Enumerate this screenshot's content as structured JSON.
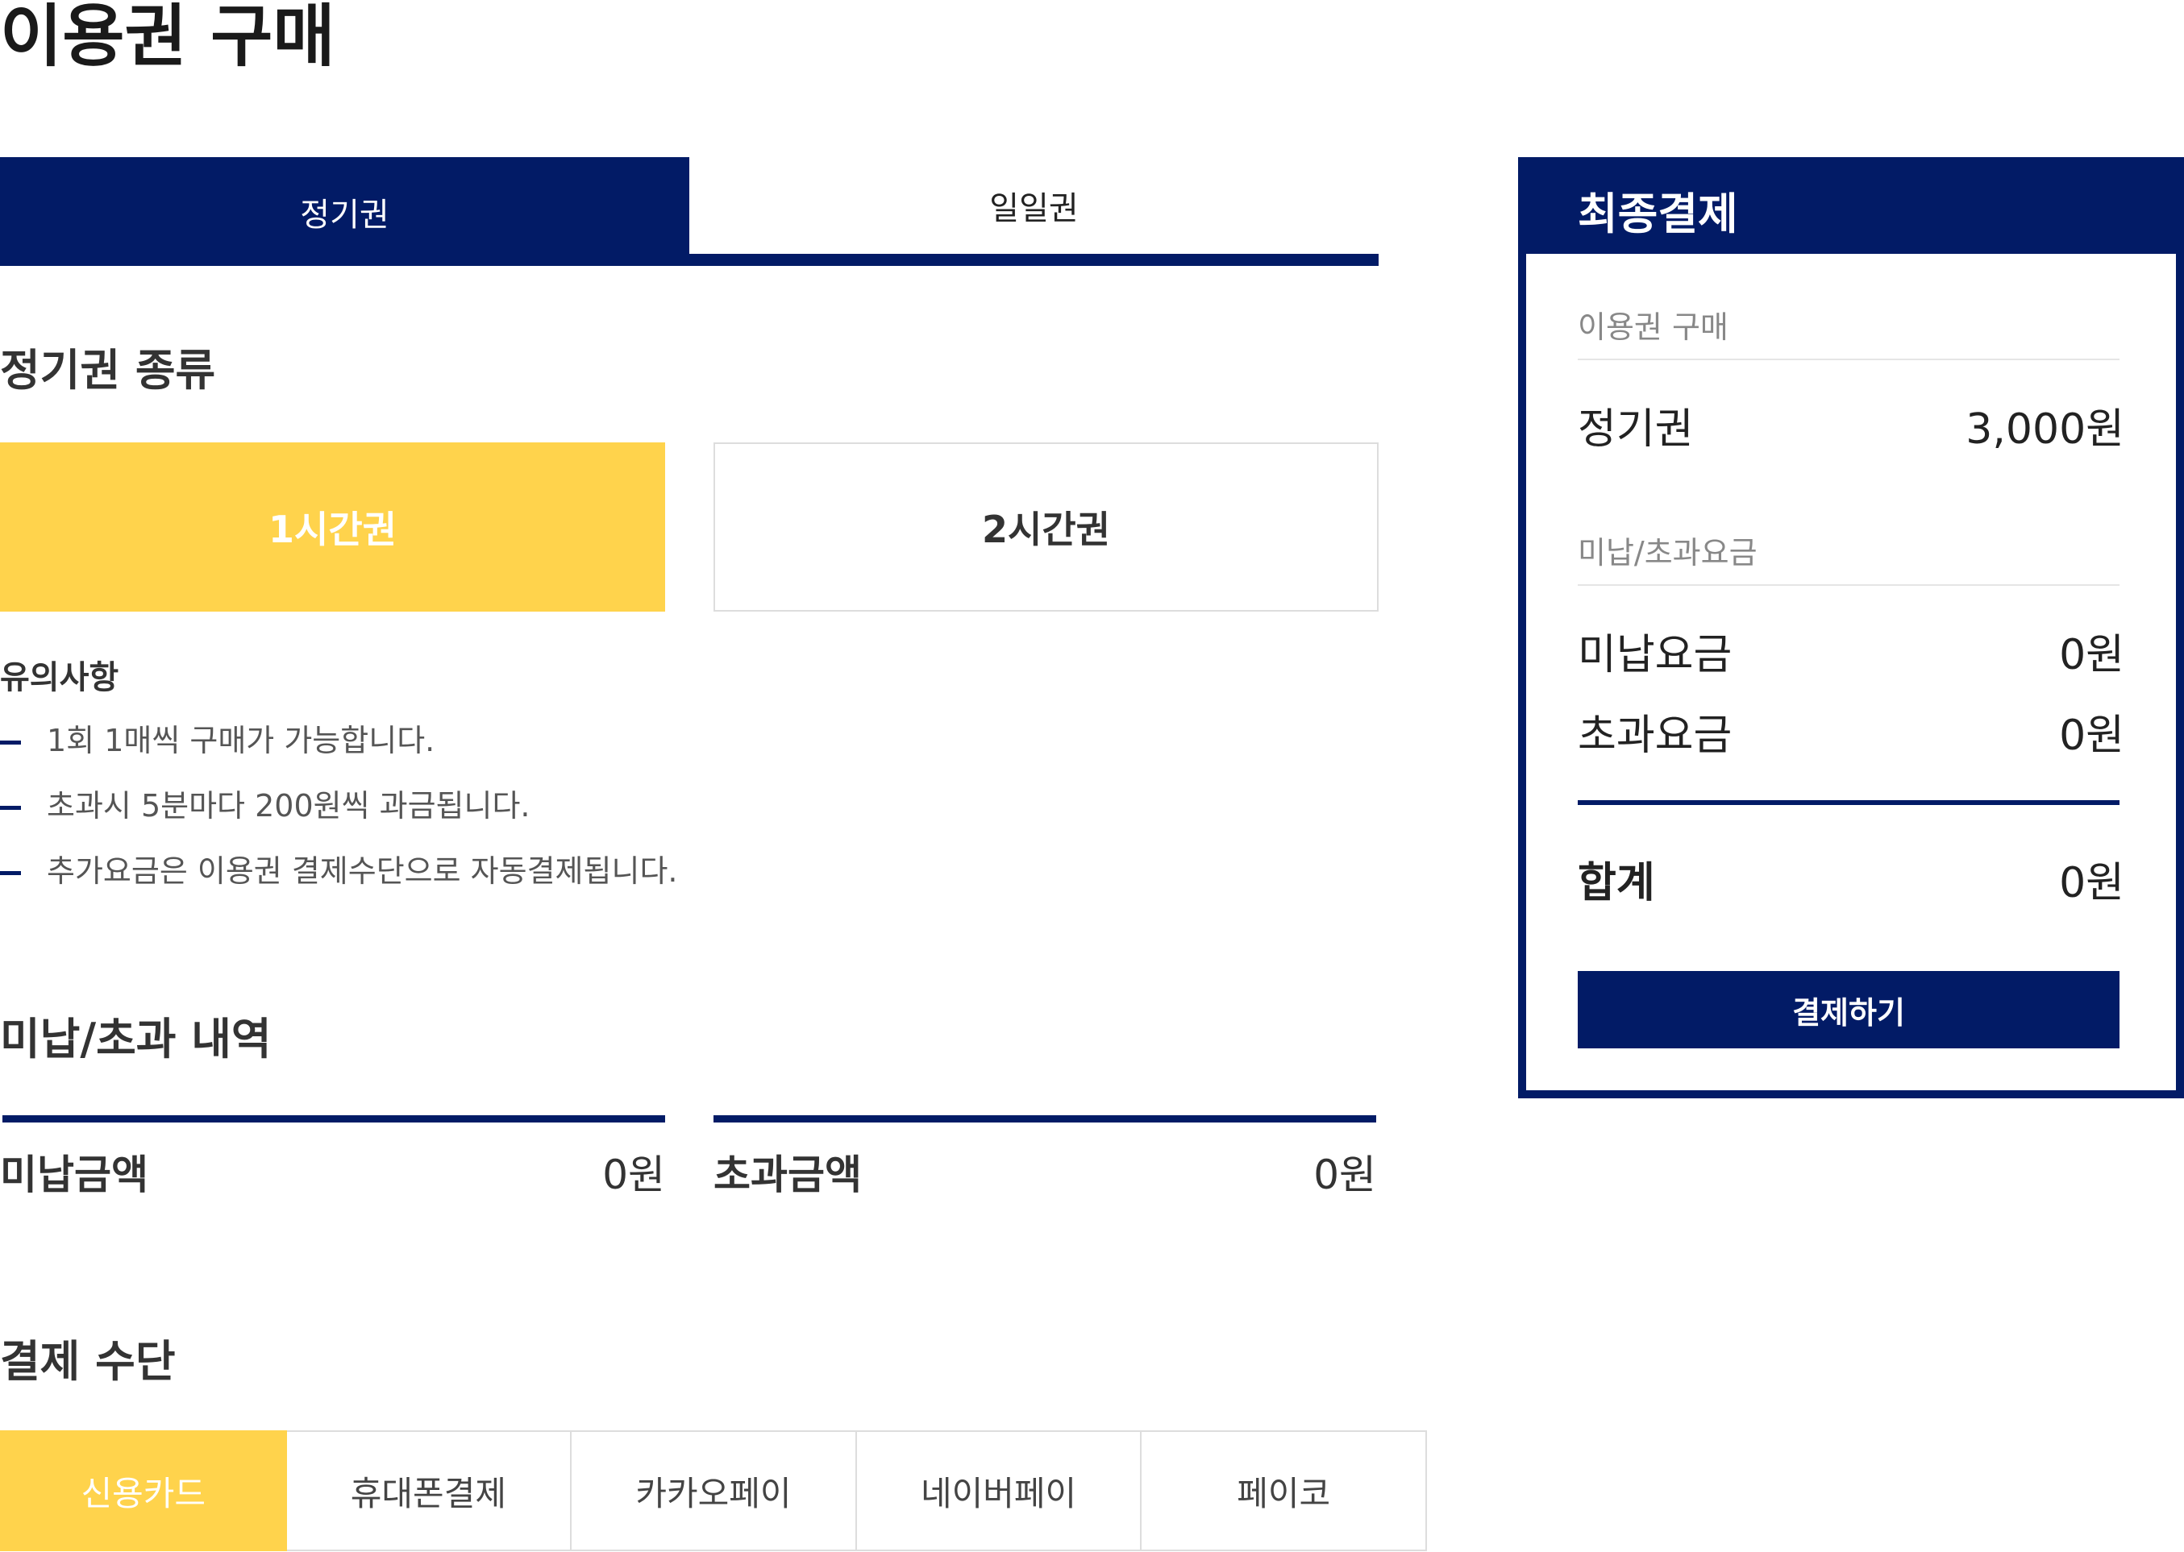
{
  "page": {
    "title": "이용권 구매"
  },
  "tabs": [
    {
      "label": "정기권",
      "active": true
    },
    {
      "label": "일일권",
      "active": false
    }
  ],
  "pass_section": {
    "title": "정기권 종류",
    "options": [
      {
        "label": "1시간권",
        "selected": true
      },
      {
        "label": "2시간권",
        "selected": false
      }
    ]
  },
  "notes": {
    "title": "유의사항",
    "items": [
      "1회 1매씩 구매가 가능합니다.",
      "초과시 5분마다 200원씩 과금됩니다.",
      "추가요금은 이용권 결제수단으로 자동결제됩니다."
    ]
  },
  "balance_section": {
    "title": "미납/초과 내역",
    "unpaid": {
      "label": "미납금액",
      "value": "0원"
    },
    "excess": {
      "label": "초과금액",
      "value": "0원"
    }
  },
  "payment_section": {
    "title": "결제 수단",
    "methods": [
      {
        "label": "신용카드",
        "selected": true
      },
      {
        "label": "휴대폰결제",
        "selected": false
      },
      {
        "label": "카카오페이",
        "selected": false
      },
      {
        "label": "네이버페이",
        "selected": false
      },
      {
        "label": "페이코",
        "selected": false
      }
    ]
  },
  "summary": {
    "title": "최종결제",
    "purchase_heading": "이용권 구매",
    "pass_label": "정기권",
    "pass_price": "3,000원",
    "fees_heading": "미납/초과요금",
    "unpaid_label": "미납요금",
    "unpaid_value": "0원",
    "excess_label": "초과요금",
    "excess_value": "0원",
    "total_label": "합계",
    "total_value": "0원",
    "submit_label": "결제하기"
  },
  "colors": {
    "navy": "#021b66",
    "yellow": "#ffd34c",
    "border": "#dddddd"
  }
}
